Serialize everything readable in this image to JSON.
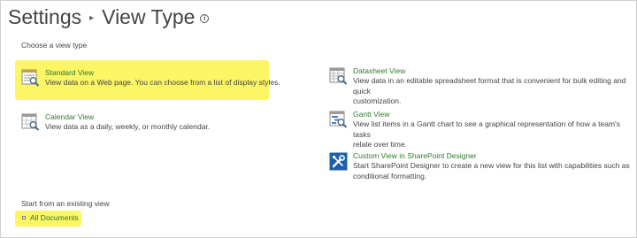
{
  "header": {
    "breadcrumb_root": "Settings",
    "breadcrumb_sep": "▸",
    "page_title": "View Type",
    "info_glyph": "i"
  },
  "choose_label": "Choose a view type",
  "view_types": {
    "standard": {
      "name": "Standard View",
      "desc_lines": [
        "View data on a Web page. You can choose from a list of display styles."
      ],
      "icon": "standard-view-icon"
    },
    "calendar": {
      "name": "Calendar View",
      "desc_lines": [
        "View data as a daily, weekly, or monthly calendar."
      ],
      "icon": "calendar-view-icon"
    },
    "datasheet": {
      "name": "Datasheet View",
      "desc_lines": [
        "View data in an editable spreadsheet format that is convenient for bulk editing and quick",
        "customization."
      ],
      "icon": "datasheet-view-icon"
    },
    "gantt": {
      "name": "Gantt View",
      "desc_lines": [
        "View list items in a Gantt chart to see a graphical representation of how a team's tasks",
        "relate over time."
      ],
      "icon": "gantt-view-icon"
    },
    "custom": {
      "name": "Custom View in SharePoint Designer",
      "desc_lines": [
        "Start SharePoint Designer to create a new view for this list with capabilities such as",
        "conditional formatting."
      ],
      "icon": "sharepoint-designer-icon"
    }
  },
  "existing_label": "Start from an existing view",
  "existing_views": [
    {
      "name": "All Documents"
    }
  ],
  "colors": {
    "highlight": "#fcf565",
    "link_green": "#2f7a2f",
    "text": "#444444",
    "designer_blue": "#1e5fa8"
  }
}
